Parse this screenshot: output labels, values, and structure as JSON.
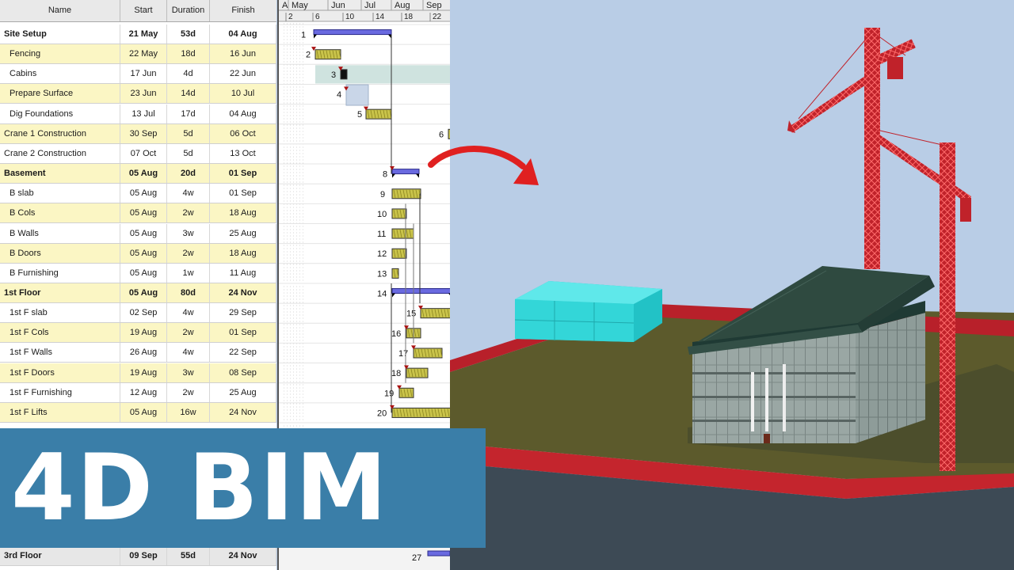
{
  "table": {
    "headers": {
      "name": "Name",
      "start": "Start",
      "duration": "Duration",
      "finish": "Finish"
    },
    "rows": [
      {
        "name": "Site Setup",
        "start": "21 May",
        "duration": "53d",
        "finish": "04 Aug",
        "bold": true,
        "style": "plain"
      },
      {
        "name": "Fencing",
        "start": "22 May",
        "duration": "18d",
        "finish": "16 Jun",
        "style": "alt"
      },
      {
        "name": "Cabins",
        "start": "17 Jun",
        "duration": "4d",
        "finish": "22 Jun",
        "style": "plain"
      },
      {
        "name": "Prepare Surface",
        "start": "23 Jun",
        "duration": "14d",
        "finish": "10 Jul",
        "style": "alt"
      },
      {
        "name": "Dig Foundations",
        "start": "13 Jul",
        "duration": "17d",
        "finish": "04 Aug",
        "style": "plain"
      },
      {
        "name": "Crane 1 Construction",
        "start": "30 Sep",
        "duration": "5d",
        "finish": "06 Oct",
        "style": "alt",
        "flush": true
      },
      {
        "name": "Crane 2 Construction",
        "start": "07 Oct",
        "duration": "5d",
        "finish": "13 Oct",
        "style": "plain",
        "flush": true
      },
      {
        "name": "Basement",
        "start": "05 Aug",
        "duration": "20d",
        "finish": "01 Sep",
        "bold": true,
        "style": "alt"
      },
      {
        "name": "B slab",
        "start": "05 Aug",
        "duration": "4w",
        "finish": "01 Sep",
        "style": "plain"
      },
      {
        "name": "B Cols",
        "start": "05 Aug",
        "duration": "2w",
        "finish": "18 Aug",
        "style": "alt"
      },
      {
        "name": "B Walls",
        "start": "05 Aug",
        "duration": "3w",
        "finish": "25 Aug",
        "style": "plain"
      },
      {
        "name": "B  Doors",
        "start": "05 Aug",
        "duration": "2w",
        "finish": "18 Aug",
        "style": "alt"
      },
      {
        "name": "B Furnishing",
        "start": "05 Aug",
        "duration": "1w",
        "finish": "11 Aug",
        "style": "plain"
      },
      {
        "name": "1st Floor",
        "start": "05 Aug",
        "duration": "80d",
        "finish": "24 Nov",
        "bold": true,
        "style": "alt",
        "flush": true
      },
      {
        "name": "1st F slab",
        "start": "02 Sep",
        "duration": "4w",
        "finish": "29 Sep",
        "style": "plain"
      },
      {
        "name": "1st F  Cols",
        "start": "19 Aug",
        "duration": "2w",
        "finish": "01 Sep",
        "style": "alt"
      },
      {
        "name": "1st F Walls",
        "start": "26 Aug",
        "duration": "4w",
        "finish": "22 Sep",
        "style": "plain"
      },
      {
        "name": "1st F  Doors",
        "start": "19 Aug",
        "duration": "3w",
        "finish": "08 Sep",
        "style": "alt"
      },
      {
        "name": "1st F Furnishing",
        "start": "12 Aug",
        "duration": "2w",
        "finish": "25 Aug",
        "style": "plain"
      },
      {
        "name": "1st F Lifts",
        "start": "05 Aug",
        "duration": "16w",
        "finish": "24 Nov",
        "style": "alt"
      }
    ],
    "bottom_row": {
      "name": "3rd Floor",
      "start": "09 Sep",
      "duration": "55d",
      "finish": "24 Nov"
    }
  },
  "gantt": {
    "months": [
      "A",
      "May",
      "Jun",
      "Jul",
      "Aug",
      "Sep"
    ],
    "days": [
      "2",
      "6",
      "10",
      "14",
      "18",
      "22"
    ],
    "row_ids": [
      "1",
      "2",
      "3",
      "4",
      "5",
      "6",
      "8",
      "9",
      "10",
      "11",
      "12",
      "13",
      "14",
      "15",
      "16",
      "17",
      "18",
      "19",
      "20"
    ],
    "bottom_row_id": "27",
    "colors": {
      "summary": "#6a6ae0",
      "task": "#c9c34a",
      "highlight": "#cfe3df",
      "arrow": "#aa1111"
    }
  },
  "banner": {
    "title": "4D BIM"
  },
  "colors": {
    "sky": "#b9cde6",
    "crane": "#d4292c",
    "cabins": "#33d6d8",
    "ground": "#5c5a2c",
    "roof": "#2f4a40",
    "banner": "#3a7ea8"
  }
}
